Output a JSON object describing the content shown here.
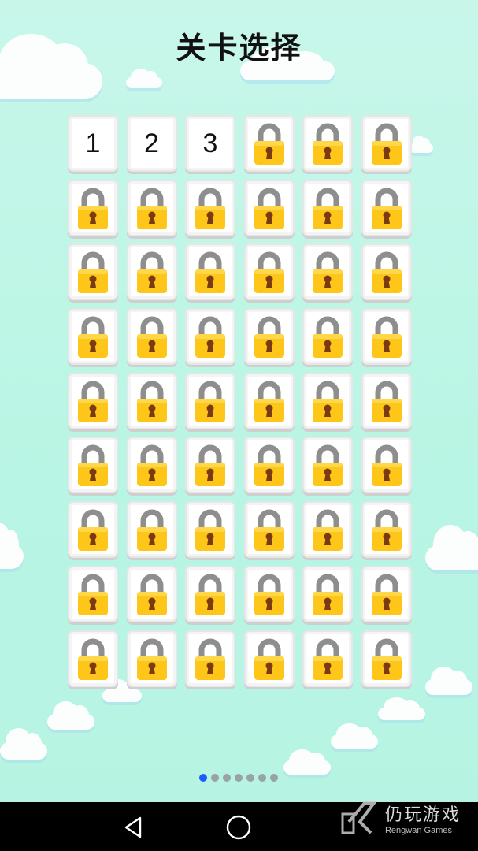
{
  "title": "关卡选择",
  "levels": [
    {
      "label": "1",
      "locked": false
    },
    {
      "label": "2",
      "locked": false
    },
    {
      "label": "3",
      "locked": false
    }
  ],
  "total_tiles": 54,
  "page_dots": 7,
  "active_page": 0,
  "colors": {
    "lock_body": "#ffc61a",
    "lock_shackle": "#8e8e8e",
    "keyhole": "#7a3b12",
    "active_dot": "#1d5cff",
    "inactive_dot": "#9aa3a3"
  },
  "watermark": {
    "cn": "仍玩游戏",
    "en": "Rengwan Games"
  },
  "nav_icons": [
    "back-icon",
    "home-icon"
  ]
}
